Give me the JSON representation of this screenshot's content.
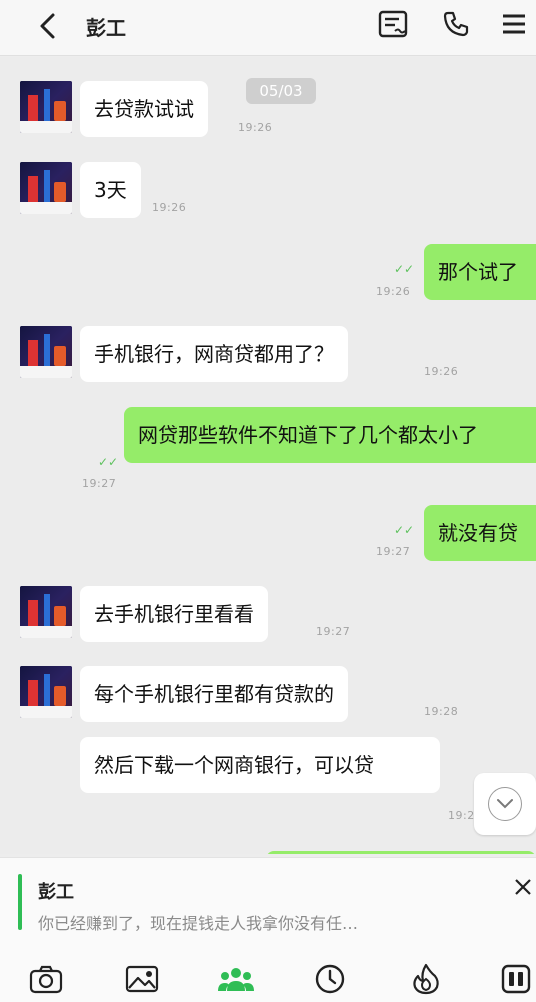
{
  "header": {
    "title": "彭工"
  },
  "chat": {
    "date_badge": "05/03",
    "messages": [
      {
        "side": "left",
        "text": "去贷款试试",
        "time": "19:26"
      },
      {
        "side": "left",
        "text": "3天",
        "time": "19:26"
      },
      {
        "side": "right",
        "text": "那个试了",
        "time": "19:26"
      },
      {
        "side": "left",
        "text": "手机银行，网商贷都用了？",
        "time": "19:26"
      },
      {
        "side": "right",
        "text": "网贷那些软件不知道下了几个都太小了",
        "time": "19:27"
      },
      {
        "side": "right",
        "text": "就没有贷",
        "time": "19:27"
      },
      {
        "side": "left",
        "text": "去手机银行里看看",
        "time": "19:27"
      },
      {
        "side": "left",
        "text": "每个手机银行里都有贷款的",
        "time": "19:28"
      },
      {
        "side": "left",
        "text": "然后下载一个网商银行，可以贷",
        "time": "19:2"
      }
    ]
  },
  "quote": {
    "name": "彭工",
    "text": "你已经赚到了，现在提钱走人我拿你没有任…"
  },
  "toolbar": {
    "items": [
      "camera-icon",
      "image-icon",
      "group-icon",
      "clock-icon",
      "fire-icon",
      "grid-icon"
    ]
  },
  "colors": {
    "sent_bubble": "#95ec69",
    "received_bubble": "#ffffff",
    "accent": "#2fbd55"
  }
}
